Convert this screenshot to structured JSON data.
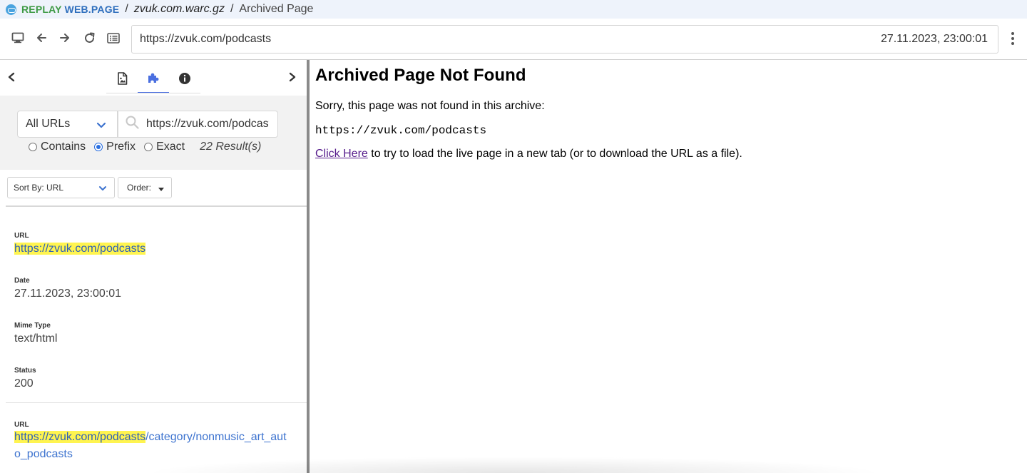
{
  "app": {
    "brand_replay": "REPLAY",
    "brand_webpage": "WEB.PAGE",
    "separator": "/",
    "archive_name": "zvuk.com.warc.gz",
    "crumb": "Archived Page"
  },
  "navbar": {
    "url": "https://zvuk.com/podcasts",
    "timestamp": "27.11.2023, 23:00:01"
  },
  "sidebar": {
    "filter": {
      "select_value": "All URLs",
      "search_value": "https://zvuk.com/podcasts",
      "radio_contains": "Contains",
      "radio_prefix": "Prefix",
      "radio_exact": "Exact",
      "selected_radio": "Prefix",
      "results": "22 Result(s)"
    },
    "sort": {
      "sort_by": "Sort By: URL",
      "order": "Order:"
    },
    "entries": [
      {
        "url_label": "URL",
        "url_highlight": "https://zvuk.com/podcasts",
        "date_label": "Date",
        "date": "27.11.2023, 23:00:01",
        "mime_label": "Mime Type",
        "mime": "text/html",
        "status_label": "Status",
        "status": "200"
      },
      {
        "url_label": "URL",
        "url_highlight": "https://zvuk.com/podcasts",
        "url_rest_line1": "/category/nonmusic_art_aut",
        "url_rest_line2": "o_podcasts"
      }
    ]
  },
  "main": {
    "title": "Archived Page Not Found",
    "sorry": "Sorry, this page was not found in this archive:",
    "missing_url": "https://zvuk.com/podcasts",
    "link_text": "Click Here",
    "link_suffix": " to try to load the live page in a new tab (or to download the URL as a file)."
  },
  "colors": {
    "brand_green": "#3e9a45",
    "brand_blue": "#2f6fbd",
    "highlight": "#fff450",
    "link_visited": "#551a8b",
    "active_tab": "#4a6fe0"
  },
  "icons": [
    "replay-logo-icon",
    "monitor-icon",
    "back-arrow-icon",
    "forward-arrow-icon",
    "reload-icon",
    "list-icon",
    "kebab-menu-icon",
    "chevron-left-icon",
    "chevron-right-icon",
    "page-resources-icon",
    "extension-icon",
    "info-icon",
    "search-icon",
    "chevron-down-icon"
  ]
}
